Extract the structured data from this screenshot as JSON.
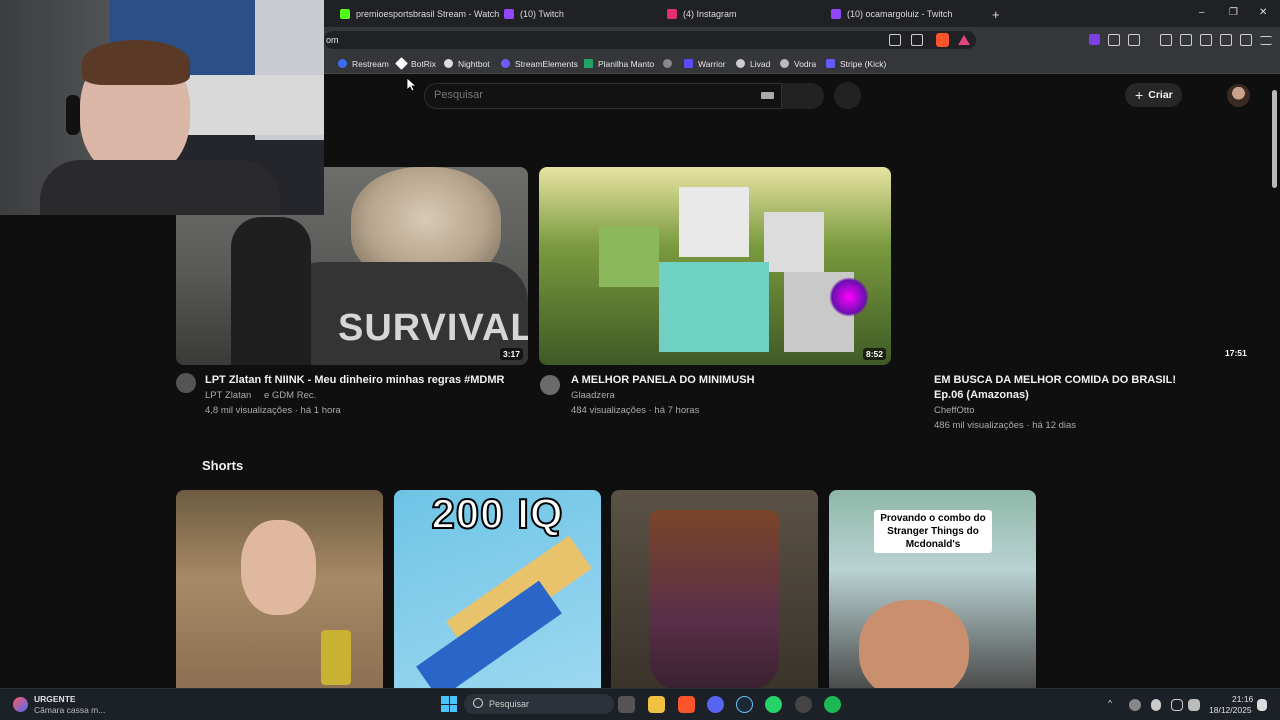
{
  "browser": {
    "tabs": [
      {
        "title": "premioesportsbrasil Stream - Watch",
        "color": "#53fc18"
      },
      {
        "title": "(10) Twitch",
        "color": "#9146ff"
      },
      {
        "title": "(4) Instagram",
        "color": "#e1306c"
      },
      {
        "title": "(10) ocamargoluiz - Twitch",
        "color": "#9146ff"
      }
    ],
    "new_tab": "+",
    "window_controls": {
      "minimize": "–",
      "restore": "❐",
      "close": "✕"
    },
    "url": "om",
    "bookmarks": [
      {
        "label": "Restream",
        "color": "#3a6cf4"
      },
      {
        "label": "BotRix",
        "color": "#ffffff"
      },
      {
        "label": "Nightbot",
        "color": "#dddddd"
      },
      {
        "label": "StreamElements",
        "color": "#6f5bff"
      },
      {
        "label": "Planilha Manto",
        "color": "#1fa463"
      },
      {
        "label": "",
        "color": "#888888"
      },
      {
        "label": "Warrior",
        "color": "#5b4bff"
      },
      {
        "label": "Livad",
        "color": "#cccccc"
      },
      {
        "label": "Vodra",
        "color": "#bbbbbb"
      },
      {
        "label": "Stripe (Kick)",
        "color": "#635bff"
      }
    ]
  },
  "youtube": {
    "search_placeholder": "Pesquisar",
    "create_label": "Criar",
    "create_plus": "+",
    "videos": [
      {
        "title": "LPT Zlatan ft NIINK - Meu dinheiro minhas regras #MDMR",
        "channel": "LPT Zlatan",
        "channel2": "e GDM Rec.",
        "meta": "4,8 mil visualizações · há 1 hora",
        "duration": "3:17"
      },
      {
        "title": "A MELHOR PANELA DO MINIMUSH",
        "channel": "Glaadzera",
        "meta": "484 visualizações · há 7 horas",
        "duration": "8:52"
      },
      {
        "title": "EM BUSCA DA MELHOR COMIDA DO BRASIL! Ep.06 (Amazonas)",
        "channel": "CheffOtto",
        "meta": "486 mil visualizações · há 12 dias",
        "duration": "17:51"
      }
    ],
    "survival_text": "SURVIVAL",
    "shorts_title": "Shorts",
    "shorts": [
      {
        "overlay": ""
      },
      {
        "overlay": "200 IQ"
      },
      {
        "overlay": ""
      },
      {
        "overlay": "Provando o combo do Stranger Things do Mcdonald's"
      }
    ]
  },
  "taskbar": {
    "notification_title": "URGENTE",
    "notification_sub": "Câmara cassa m...",
    "search_label": "Pesquisar",
    "time": "21:16",
    "date": "18/12/2025"
  }
}
